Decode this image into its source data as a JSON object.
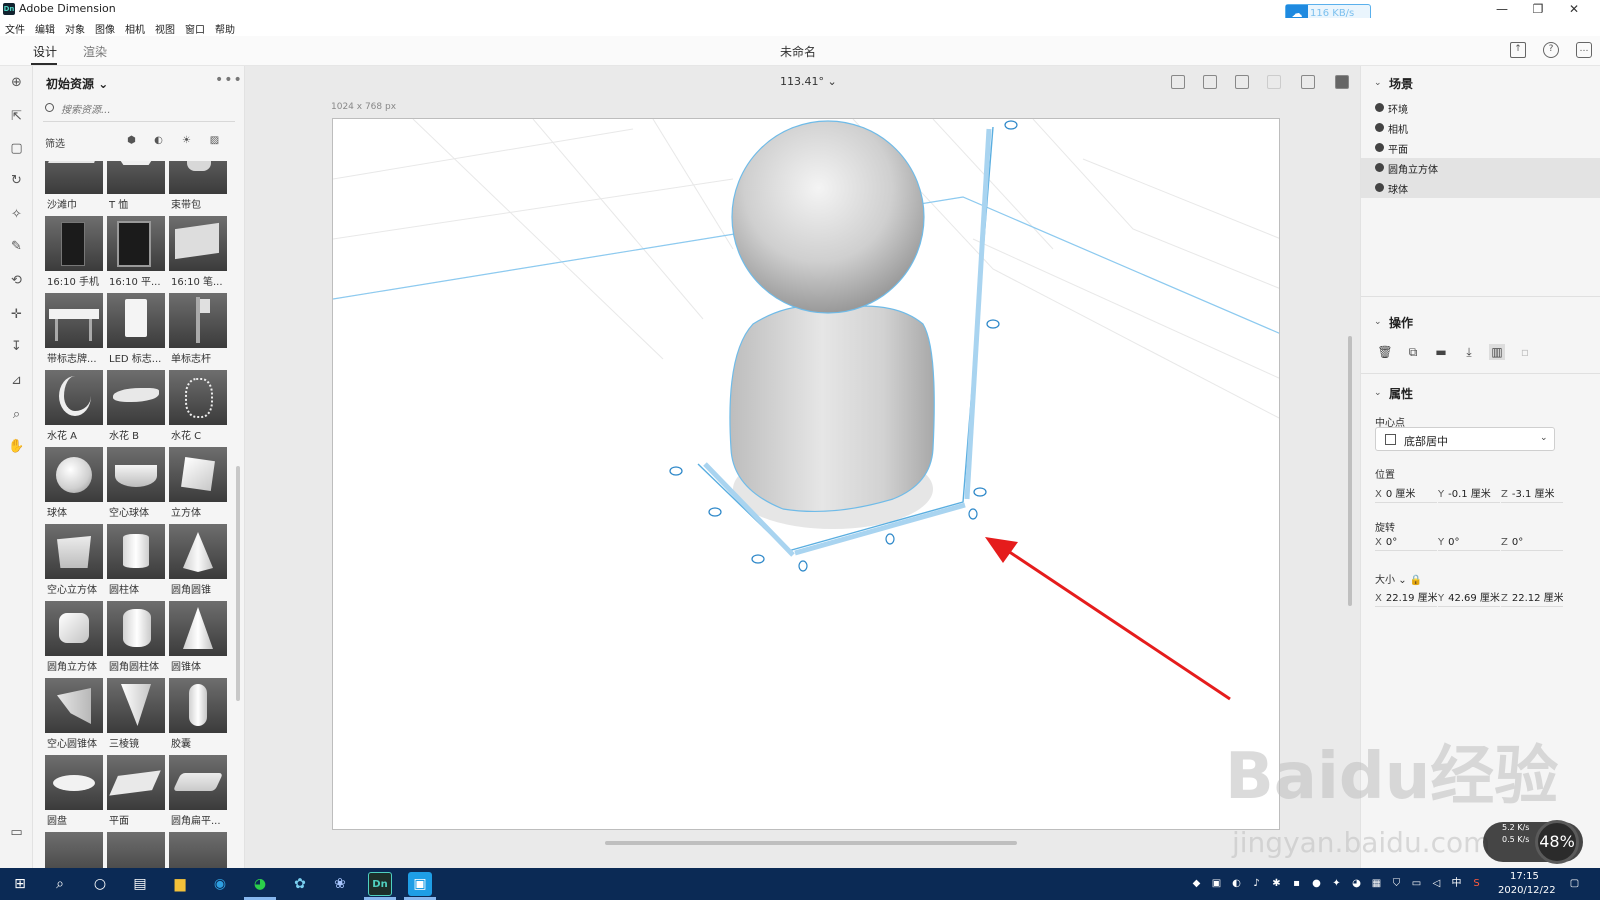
{
  "window": {
    "app_title": "Adobe Dimension",
    "net_rate": "116 KB/s"
  },
  "menu": [
    "文件",
    "编辑",
    "对象",
    "图像",
    "相机",
    "视图",
    "窗口",
    "帮助"
  ],
  "tabs": {
    "design": "设计",
    "render": "渲染"
  },
  "document": {
    "title": "未命名"
  },
  "canvas": {
    "zoom": "113.41°",
    "size_label": "1024 x 768 px"
  },
  "assets": {
    "title": "初始资源",
    "search_placeholder": "搜索资源...",
    "filter_label": "筛选",
    "items": [
      "沙滩巾",
      "T 恤",
      "束带包",
      "16:10 手机",
      "16:10 平...",
      "16:10 笔...",
      "带标志牌...",
      "LED 标志...",
      "单标志杆",
      "水花 A",
      "水花 B",
      "水花 C",
      "球体",
      "空心球体",
      "立方体",
      "空心立方体",
      "圆柱体",
      "圆角圆锥",
      "圆角立方体",
      "圆角圆柱体",
      "圆锥体",
      "空心圆锥体",
      "三棱镜",
      "胶囊",
      "圆盘",
      "平面",
      "圆角扁平..."
    ]
  },
  "scene": {
    "title": "场景",
    "items": [
      "环境",
      "相机",
      "平面",
      "圆角立方体",
      "球体"
    ],
    "selected": [
      "圆角立方体",
      "球体"
    ]
  },
  "actions": {
    "title": "操作"
  },
  "properties": {
    "title": "属性",
    "pivot_label": "中心点",
    "pivot_value": "底部居中",
    "position_label": "位置",
    "position": {
      "x": "0 厘米",
      "y": "-0.1 厘米",
      "z": "-3.1 厘米"
    },
    "rotation_label": "旋转",
    "rotation": {
      "x": "0°",
      "y": "0°",
      "z": "0°"
    },
    "size_label": "大小",
    "size": {
      "x": "22.19 厘米",
      "y": "42.69 厘米",
      "z": "22.12 厘米"
    }
  },
  "taskbar": {
    "time": "17:15",
    "date": "2020/12/22",
    "ime": "中"
  },
  "overlay": {
    "speed_up": "5.2 K/s",
    "speed_down": "0.5 K/s",
    "percent": "48%",
    "watermark": "Baidu经验",
    "watermark_sub": "jingyan.baidu.com"
  },
  "colors": {
    "selection": "#5aaee0",
    "arrow": "#e51c1c",
    "taskbar": "#0b2a55"
  }
}
